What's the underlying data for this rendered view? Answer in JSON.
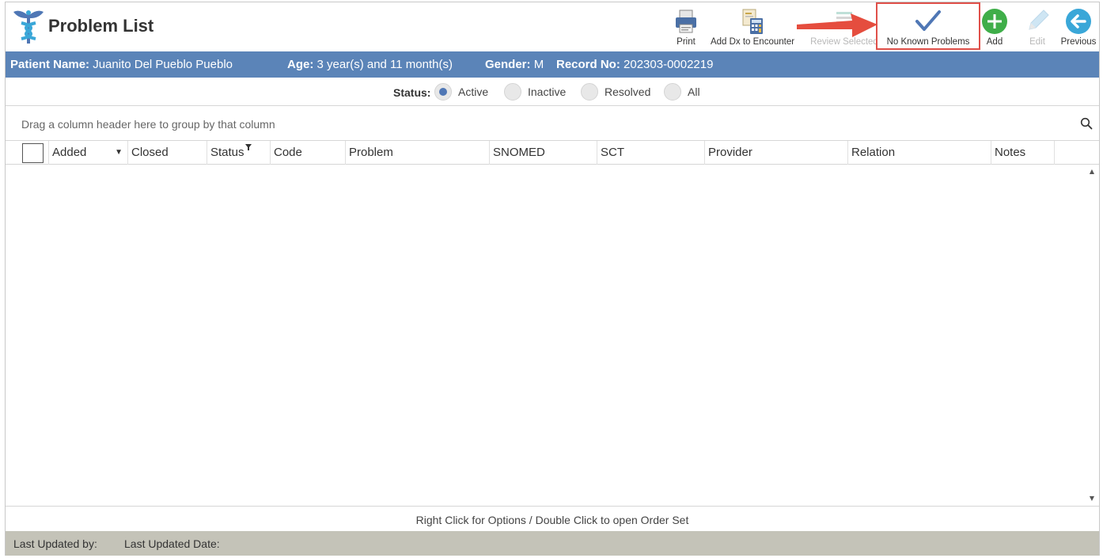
{
  "app": {
    "title": "Problem List"
  },
  "toolbar": {
    "print": "Print",
    "add_dx": "Add Dx to Encounter",
    "review_selected": "Review Selected",
    "no_known_problems": "No Known Problems",
    "add": "Add",
    "edit": "Edit",
    "previous": "Previous"
  },
  "patient": {
    "name_label": "Patient Name:",
    "name": "Juanito Del Pueblo Pueblo",
    "age_label": "Age:",
    "age": "3 year(s) and 11 month(s)",
    "gender_label": "Gender:",
    "gender": "M",
    "record_label": "Record No:",
    "record": "202303-0002219"
  },
  "status": {
    "label": "Status:",
    "options": [
      "Active",
      "Inactive",
      "Resolved",
      "All"
    ],
    "selected": "Active"
  },
  "grid": {
    "group_hint": "Drag a column header here to group by that column",
    "columns": [
      "Added",
      "Closed",
      "Status",
      "Code",
      "Problem",
      "SNOMED",
      "SCT",
      "Provider",
      "Relation",
      "Notes"
    ],
    "rows": []
  },
  "hints": {
    "options": "Right Click for Options / Double Click to open Order Set"
  },
  "footer": {
    "last_updated_by": "Last Updated by:",
    "last_updated_date": "Last Updated Date:"
  },
  "colors": {
    "patient_bar": "#5b84b8",
    "accent_blue": "#4f77b5",
    "add_green": "#3fae49",
    "previous_teal": "#3aa7d8",
    "highlight_red": "#e0504a",
    "footer_bg": "#c4c3b8"
  },
  "icons": {
    "logo": "caduceus-logo-icon",
    "print": "printer-icon",
    "add_dx": "calculator-document-icon",
    "review": "review-list-icon",
    "no_known": "checkmark-icon",
    "add": "plus-circle-icon",
    "edit": "pencil-icon",
    "previous": "back-arrow-circle-icon",
    "search": "search-icon"
  }
}
